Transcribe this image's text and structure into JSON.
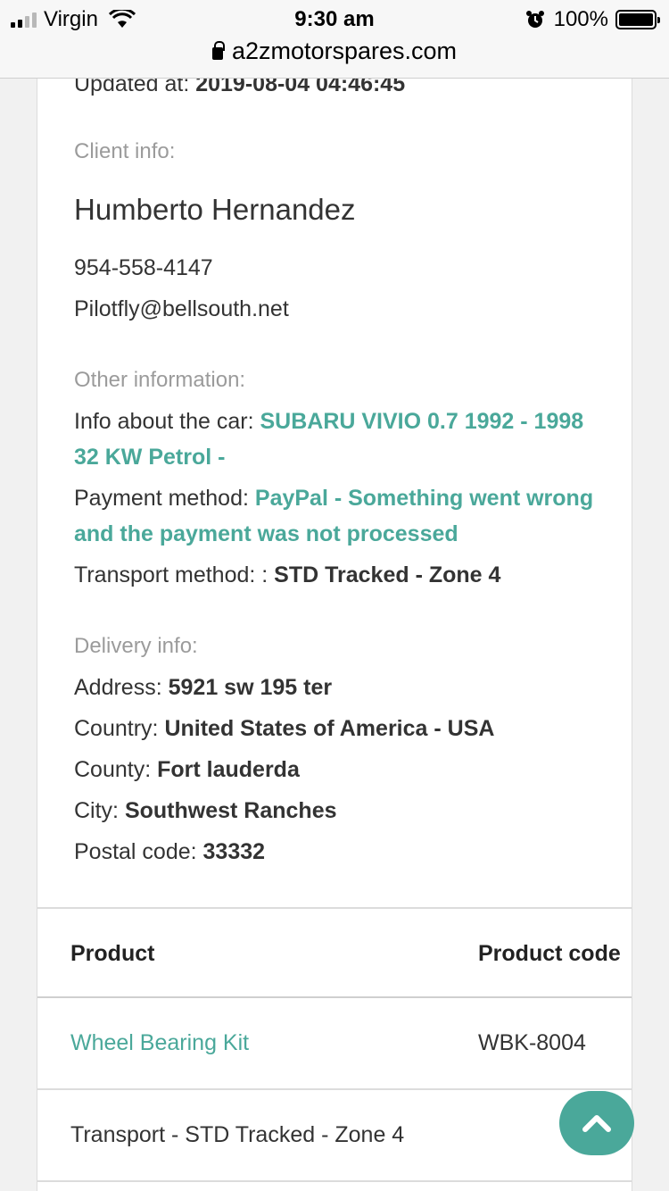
{
  "status_bar": {
    "carrier": "Virgin",
    "time": "9:30 am",
    "battery": "100%",
    "url": "a2zmotorspares.com"
  },
  "order": {
    "updated_label": "Updated at:",
    "updated_value": "2019-08-04 04:46:45"
  },
  "client": {
    "heading": "Client info:",
    "name": "Humberto Hernandez",
    "phone": "954-558-4147",
    "email": "Pilotfly@bellsouth.net"
  },
  "other": {
    "heading": "Other information:",
    "car_label": "Info about the car: ",
    "car_value_line1": "SUBARU VIVIO 0.7 1992 - 1998",
    "car_value_line2": "32 KW Petrol -",
    "payment_label": "Payment method: ",
    "payment_value_line1": "PayPal - Something went wrong",
    "payment_value_line2": "and the payment was not processed",
    "transport_label": "Transport method: : ",
    "transport_value": "STD Tracked - Zone 4"
  },
  "delivery": {
    "heading": "Delivery info:",
    "address_label": "Address: ",
    "address_value": "5921 sw 195 ter",
    "country_label": "Country: ",
    "country_value": "United States of America - USA",
    "county_label": "County: ",
    "county_value": "Fort lauderda",
    "city_label": "City: ",
    "city_value": "Southwest Ranches",
    "postal_label": "Postal code: ",
    "postal_value": "33332"
  },
  "table": {
    "headers": [
      "Product",
      "Product code"
    ],
    "rows": [
      [
        "Wheel Bearing Kit",
        "WBK-8004"
      ],
      [
        "Transport - STD Tracked - Zone 4",
        ""
      ]
    ]
  },
  "icons": {
    "scroll_top": "chevron-up-icon",
    "accent": "#4aa89a"
  }
}
